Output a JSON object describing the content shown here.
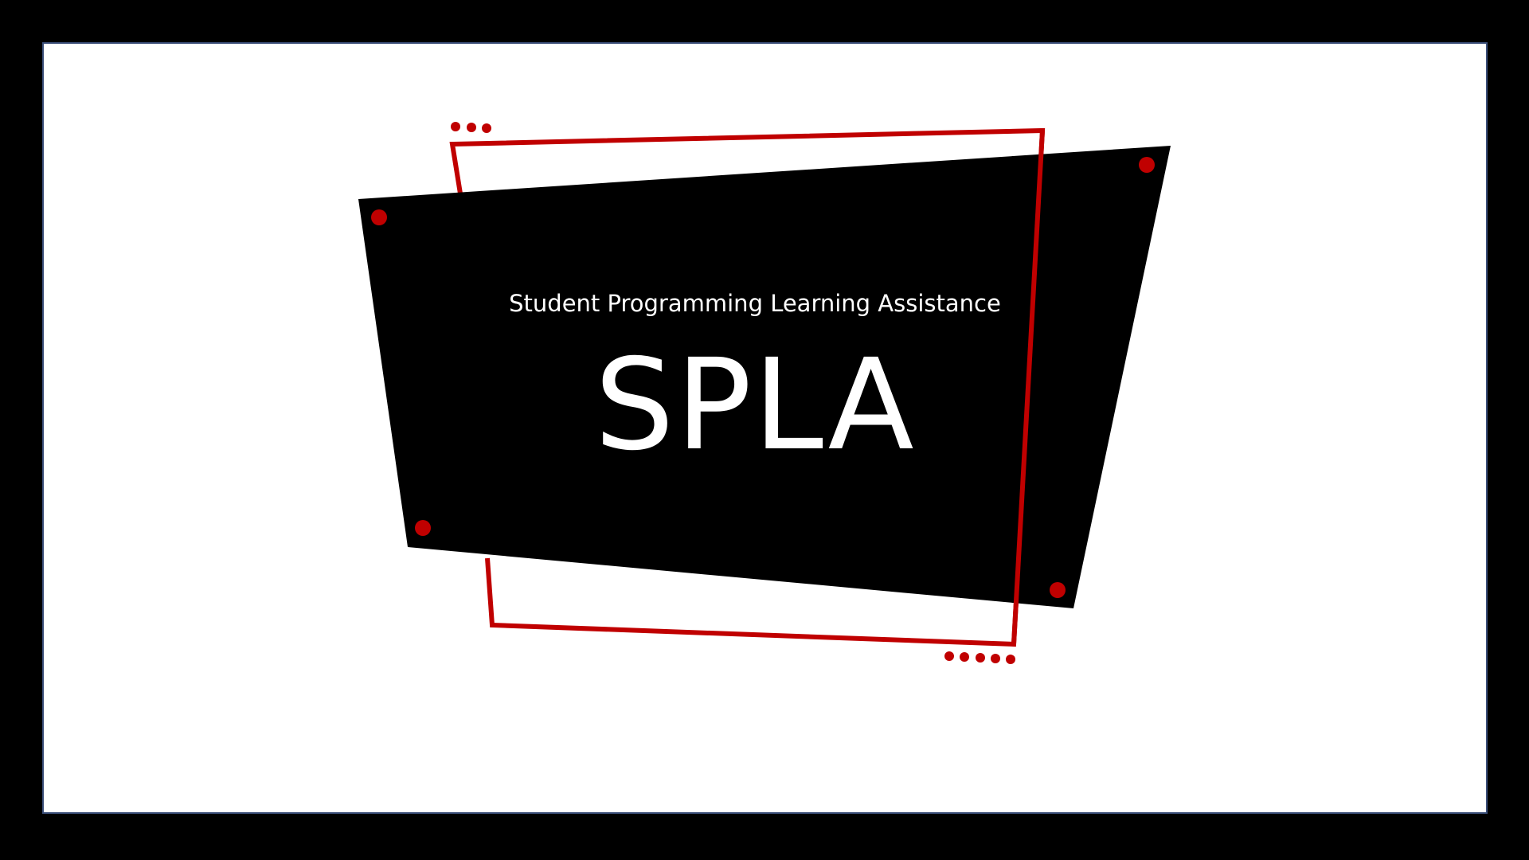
{
  "slide": {
    "subtitle": "Student Programming Learning Assistance",
    "title": "SPLA"
  },
  "colors": {
    "background": "#ffffff",
    "outer": "#000000",
    "shape_fill": "#000000",
    "accent": "#c00000",
    "border": "#3b4f7a",
    "text": "#ffffff"
  }
}
